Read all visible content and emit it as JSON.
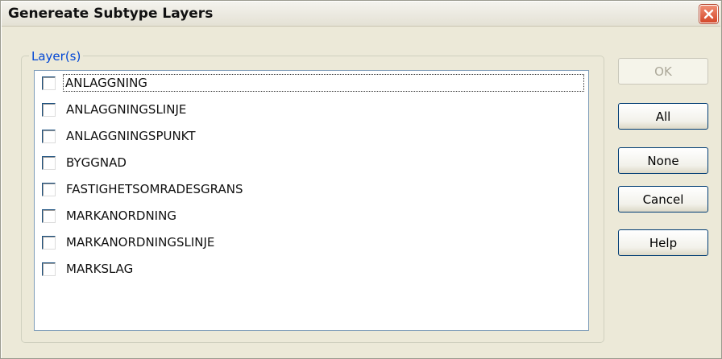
{
  "window": {
    "title": "Genereate Subtype Layers"
  },
  "group": {
    "legend": "Layer(s)"
  },
  "layers": [
    {
      "label": "ANLAGGNING",
      "checked": false
    },
    {
      "label": "ANLAGGNINGSLINJE",
      "checked": false
    },
    {
      "label": "ANLAGGNINGSPUNKT",
      "checked": false
    },
    {
      "label": "BYGGNAD",
      "checked": false
    },
    {
      "label": "FASTIGHETSOMRADESGRANS",
      "checked": false
    },
    {
      "label": "MARKANORDNING",
      "checked": false
    },
    {
      "label": "MARKANORDNINGSLINJE",
      "checked": false
    },
    {
      "label": "MARKSLAG",
      "checked": false
    }
  ],
  "buttons": {
    "ok": "OK",
    "all": "All",
    "none": "None",
    "cancel": "Cancel",
    "help": "Help"
  },
  "icons": {
    "close": "close-icon"
  }
}
